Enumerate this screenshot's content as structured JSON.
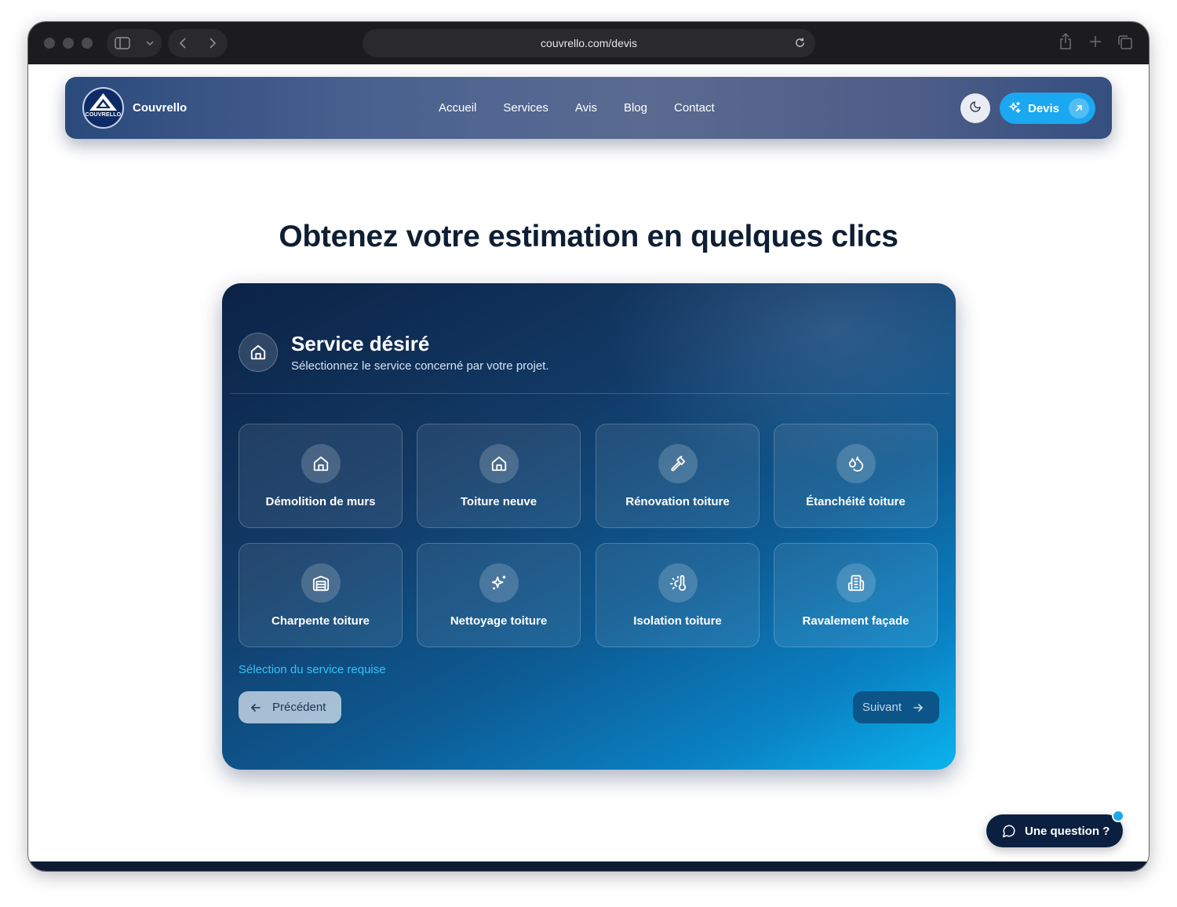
{
  "browser": {
    "url": "couvrello.com/devis"
  },
  "header": {
    "logo_text": "COUVRELLO",
    "brand": "Couvrello",
    "nav": [
      {
        "label": "Accueil"
      },
      {
        "label": "Services"
      },
      {
        "label": "Avis"
      },
      {
        "label": "Blog"
      },
      {
        "label": "Contact"
      }
    ],
    "theme_icon": "moon-icon",
    "cta_label": "Devis"
  },
  "page": {
    "title": "Obtenez votre estimation en quelques clics"
  },
  "form": {
    "step_icon": "home-icon",
    "step_title": "Service désiré",
    "step_subtitle": "Sélectionnez le service concerné par votre projet.",
    "services": [
      {
        "label": "Démolition de murs",
        "icon": "home-icon"
      },
      {
        "label": "Toiture neuve",
        "icon": "home-icon"
      },
      {
        "label": "Rénovation toiture",
        "icon": "hammer-icon"
      },
      {
        "label": "Étanchéité toiture",
        "icon": "droplets-icon"
      },
      {
        "label": "Charpente toiture",
        "icon": "warehouse-icon"
      },
      {
        "label": "Nettoyage toiture",
        "icon": "sparkles-icon"
      },
      {
        "label": "Isolation toiture",
        "icon": "thermometer-sun-icon"
      },
      {
        "label": "Ravalement façade",
        "icon": "building-icon"
      }
    ],
    "validation_message": "Sélection du service requise",
    "prev_label": "Précédent",
    "next_label": "Suivant"
  },
  "chat": {
    "label": "Une question ?"
  },
  "colors": {
    "accent": "#1aa8f0",
    "title": "#0e1e33",
    "error": "#34c3f7",
    "chat_bg": "#0b2040"
  }
}
